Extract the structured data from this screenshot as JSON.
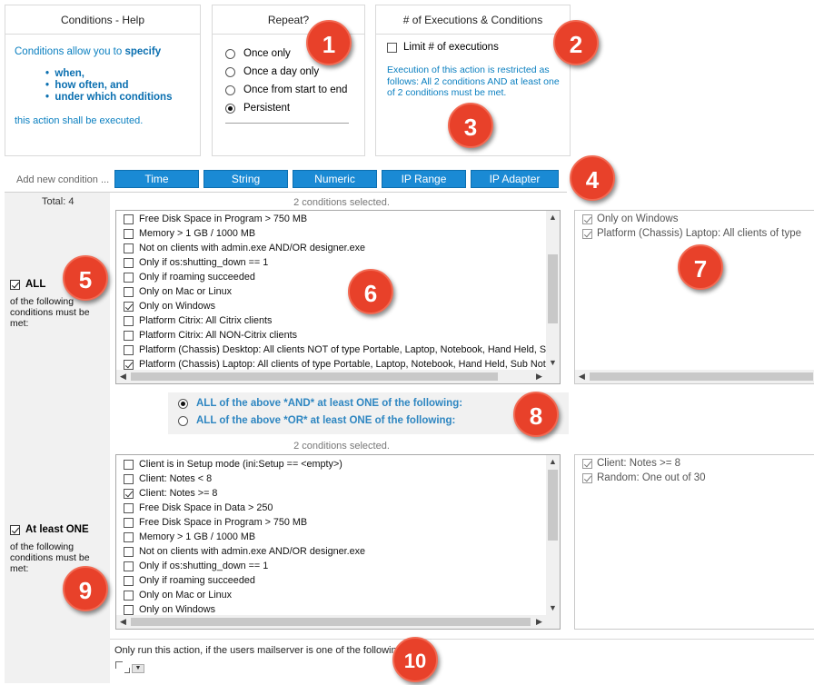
{
  "help": {
    "title": "Conditions - Help",
    "intro": "Conditions allow you to ",
    "intro_bold": "specify",
    "bullets": [
      "when,",
      "how often, and",
      "under which conditions"
    ],
    "outro": "this action shall be executed."
  },
  "repeat": {
    "title": "Repeat?",
    "options": [
      "Once only",
      "Once a day only",
      "Once from start to end",
      "Persistent"
    ],
    "selected_index": 3
  },
  "executions": {
    "title": "# of Executions & Conditions",
    "limit_label": "Limit # of executions",
    "limit_checked": false,
    "description": "Execution of this action is restricted as follows: All 2 conditions AND at least one of 2 conditions must be met."
  },
  "add_condition": {
    "label": "Add new condition ...",
    "buttons": [
      "Time",
      "String",
      "Numeric",
      "IP Range",
      "IP Adapter"
    ]
  },
  "total": "Total: 4",
  "group_all": {
    "selected_count": "2 conditions selected.",
    "checkbox_label": "ALL",
    "checked": true,
    "description": "of the following conditions must be met:",
    "items": [
      {
        "label": "Free Disk Space in Program > 750 MB",
        "checked": false
      },
      {
        "label": "Memory > 1 GB / 1000 MB",
        "checked": false
      },
      {
        "label": "Not on clients with admin.exe AND/OR designer.exe",
        "checked": false
      },
      {
        "label": "Only if os:shutting_down == 1",
        "checked": false
      },
      {
        "label": "Only if roaming succeeded",
        "checked": false
      },
      {
        "label": "Only on Mac or Linux",
        "checked": false
      },
      {
        "label": "Only on Windows",
        "checked": true
      },
      {
        "label": "Platform Citrix: All Citrix clients",
        "checked": false
      },
      {
        "label": "Platform Citrix: All NON-Citrix clients",
        "checked": false
      },
      {
        "label": "Platform (Chassis) Desktop: All clients NOT of type Portable, Laptop, Notebook, Hand Held, Sub",
        "checked": false
      },
      {
        "label": "Platform (Chassis) Laptop: All clients of type Portable, Laptop, Notebook, Hand Held, Sub Note",
        "checked": true
      }
    ],
    "selected": [
      "Only on Windows",
      "Platform (Chassis) Laptop: All clients of type"
    ]
  },
  "combinator": {
    "options": [
      "ALL of the above *AND* at least ONE of the following:",
      "ALL of the above *OR* at least ONE of the following:"
    ],
    "selected_index": 0
  },
  "group_one": {
    "selected_count": "2 conditions selected.",
    "checkbox_label": "At least ONE",
    "checked": true,
    "description": "of the following conditions must be met:",
    "items": [
      {
        "label": "Client is in Setup mode (ini:Setup == <empty>)",
        "checked": false
      },
      {
        "label": "Client: Notes < 8",
        "checked": false
      },
      {
        "label": "Client: Notes >= 8",
        "checked": true
      },
      {
        "label": "Free Disk Space in Data > 250",
        "checked": false
      },
      {
        "label": "Free Disk Space in Program > 750 MB",
        "checked": false
      },
      {
        "label": "Memory > 1 GB / 1000 MB",
        "checked": false
      },
      {
        "label": "Not on clients with admin.exe AND/OR designer.exe",
        "checked": false
      },
      {
        "label": "Only if os:shutting_down == 1",
        "checked": false
      },
      {
        "label": "Only if roaming succeeded",
        "checked": false
      },
      {
        "label": "Only on Mac or Linux",
        "checked": false
      },
      {
        "label": "Only on Windows",
        "checked": false
      }
    ],
    "selected": [
      "Client: Notes >= 8",
      "Random: One out of 30"
    ]
  },
  "mailserver": {
    "label": "Only run this action, if the users mailserver is one of the following:"
  },
  "badges": [
    "1",
    "2",
    "3",
    "4",
    "5",
    "6",
    "7",
    "8",
    "9",
    "10"
  ],
  "colors": {
    "accent_blue": "#1a8ad4",
    "help_text": "#0a7fc0",
    "badge_red": "#e8412a"
  }
}
